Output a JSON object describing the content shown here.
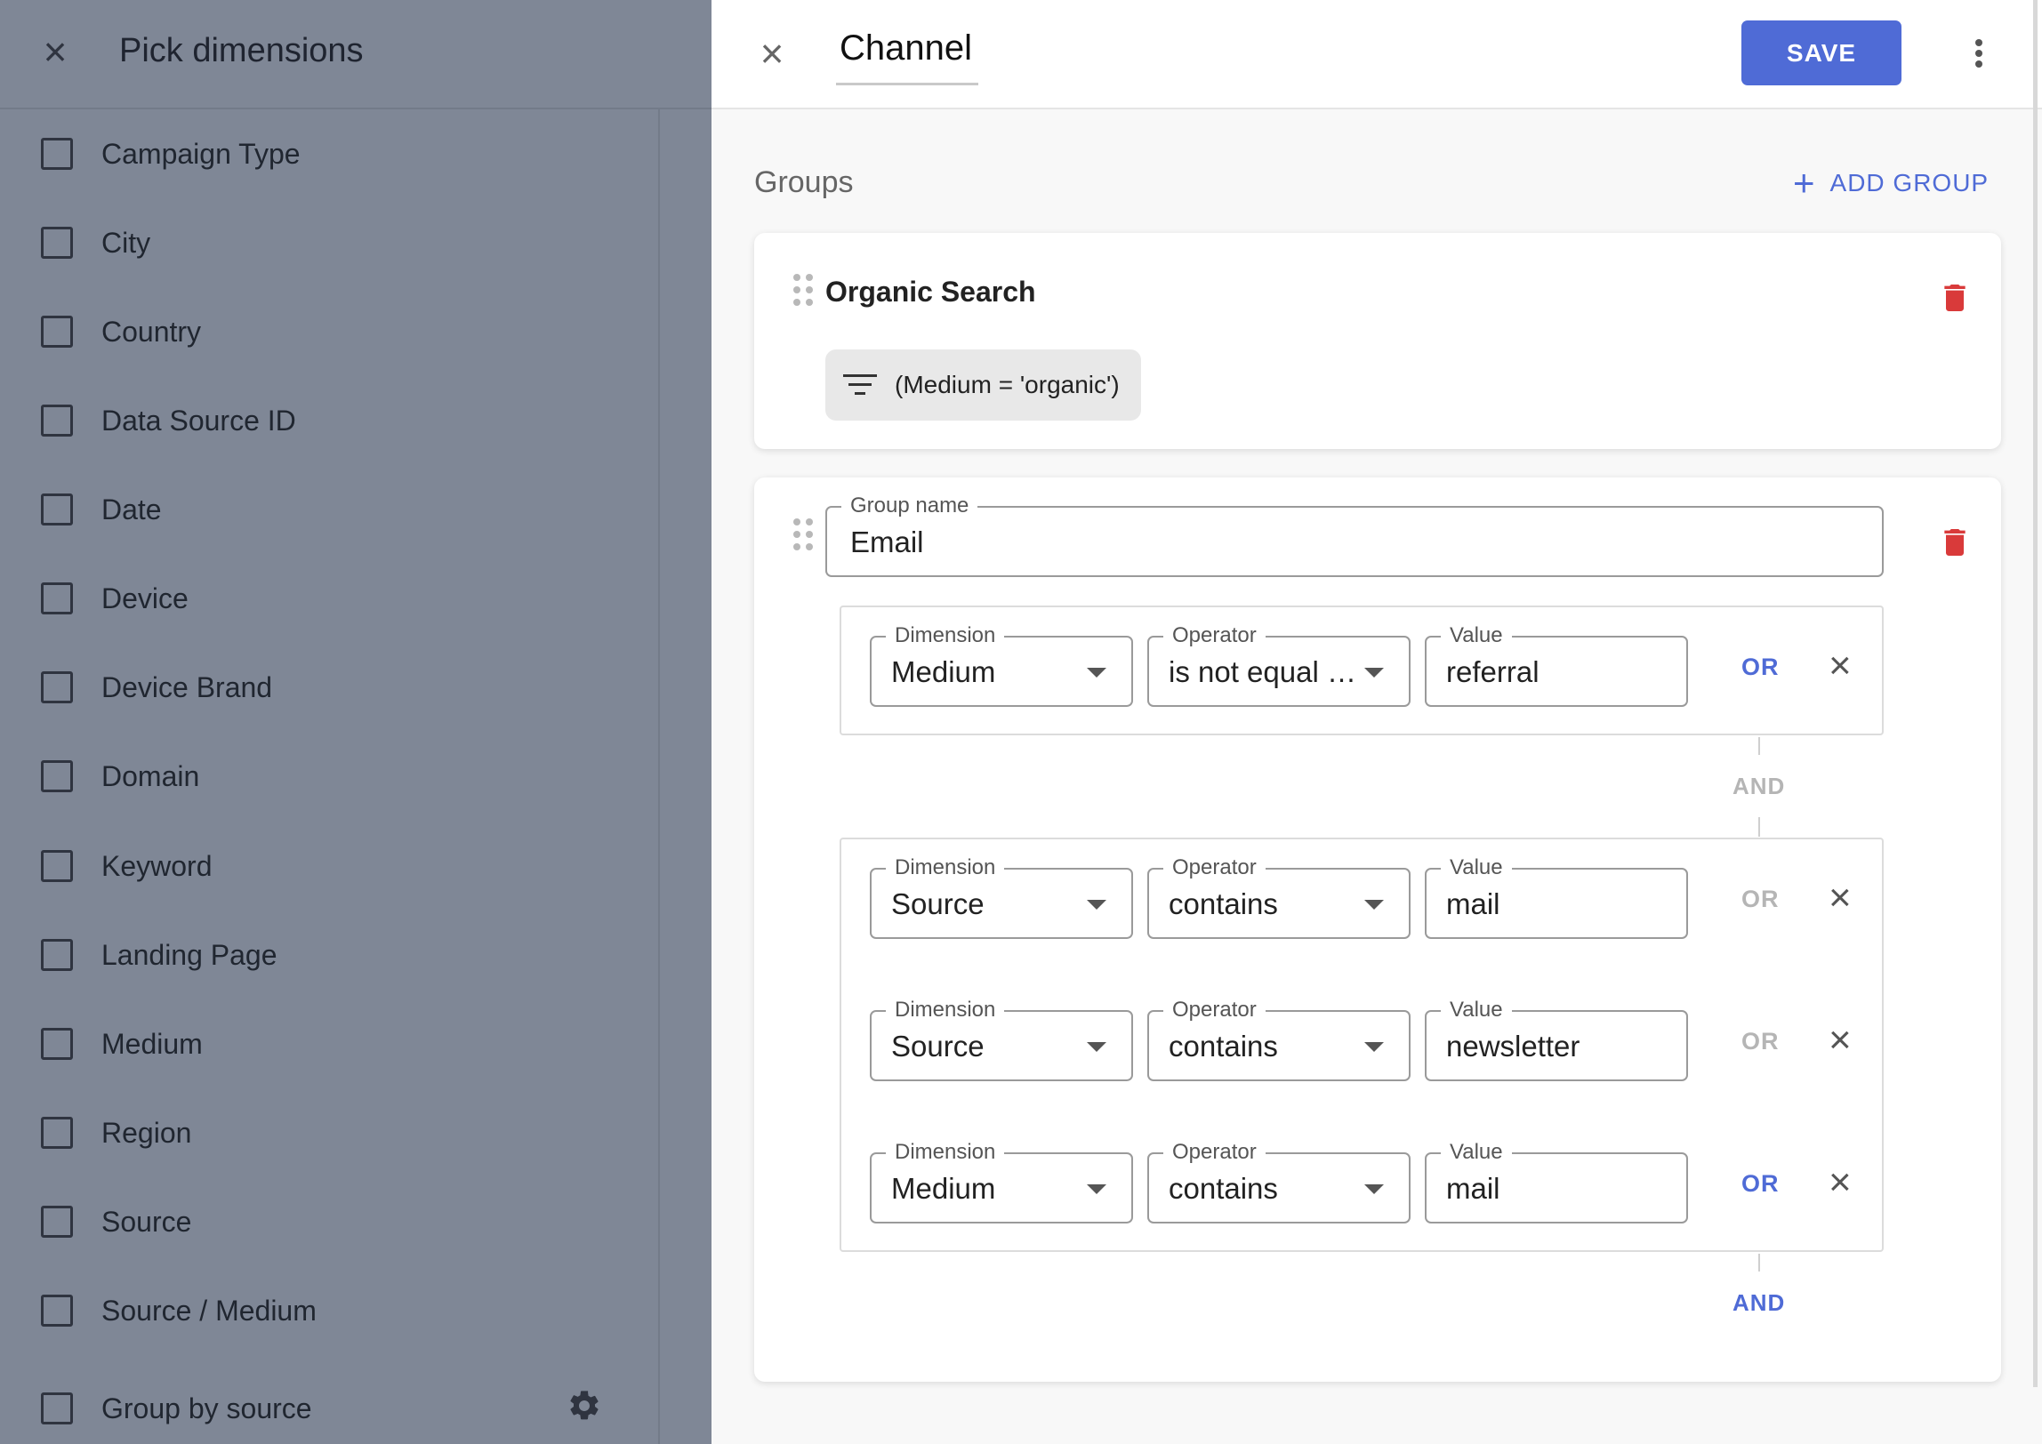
{
  "left_panel": {
    "title": "Pick dimensions",
    "items": [
      {
        "label": "Campaign Type"
      },
      {
        "label": "City"
      },
      {
        "label": "Country"
      },
      {
        "label": "Data Source ID"
      },
      {
        "label": "Date"
      },
      {
        "label": "Device"
      },
      {
        "label": "Device Brand"
      },
      {
        "label": "Domain"
      },
      {
        "label": "Keyword"
      },
      {
        "label": "Landing Page"
      },
      {
        "label": "Medium"
      },
      {
        "label": "Region"
      },
      {
        "label": "Source"
      },
      {
        "label": "Source / Medium"
      },
      {
        "label": "Group by source"
      }
    ]
  },
  "editor": {
    "title_value": "Channel",
    "save_label": "SAVE",
    "groups_label": "Groups",
    "add_group_label": "ADD GROUP",
    "group1": {
      "name": "Organic Search",
      "filter_chip": "(Medium = 'organic')"
    },
    "group2": {
      "name_label": "Group name",
      "name_value": "Email",
      "field_labels": {
        "dimension": "Dimension",
        "operator": "Operator",
        "value": "Value"
      },
      "block1": {
        "rows": [
          {
            "dimension": "Medium",
            "operator": "is not equal …",
            "value": "referral",
            "or": "OR"
          }
        ],
        "and_label": "AND"
      },
      "block2": {
        "rows": [
          {
            "dimension": "Source",
            "operator": "contains",
            "value": "mail",
            "or": "OR"
          },
          {
            "dimension": "Source",
            "operator": "contains",
            "value": "newsletter",
            "or": "OR"
          },
          {
            "dimension": "Medium",
            "operator": "contains",
            "value": "mail",
            "or": "OR"
          }
        ],
        "and_label": "AND"
      }
    }
  },
  "colors": {
    "accent": "#4f6bd6",
    "delete": "#d93a3a",
    "overlay": "#7f8796"
  }
}
